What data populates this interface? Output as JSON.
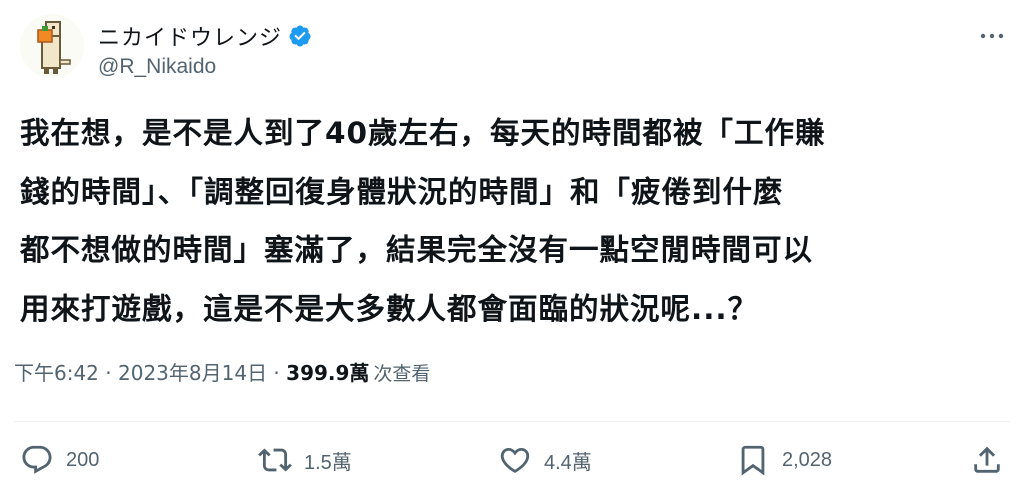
{
  "user": {
    "display_name": "ニカイドウレンジ",
    "handle": "@R_Nikaido",
    "avatar_icon": "pixel-dog-with-orange-icon",
    "verified_icon": "verified-badge-icon",
    "verified_color": "#1d9bf0"
  },
  "tweet": {
    "text": "我在想，是不是人到了40歲左右，每天的時間都被「工作賺\n錢的時間」、「調整回復身體狀況的時間」和「疲倦到什麼\n都不想做的時間」塞滿了，結果完全沒有一點空閒時間可以\n用來打遊戲，這是不是大多數人都會面臨的狀況呢...？"
  },
  "meta": {
    "time": "下午6:42",
    "sep1": " · ",
    "date": "2023年8月14日",
    "sep2": " · ",
    "views_count": "399.9萬",
    "views_label": "次查看"
  },
  "actions": {
    "replies": "200",
    "retweets": "1.5萬",
    "likes": "4.4萬",
    "bookmarks": "2,028"
  },
  "colors": {
    "text": "#0f1419",
    "secondary": "#536471",
    "divider": "#eff3f4"
  }
}
